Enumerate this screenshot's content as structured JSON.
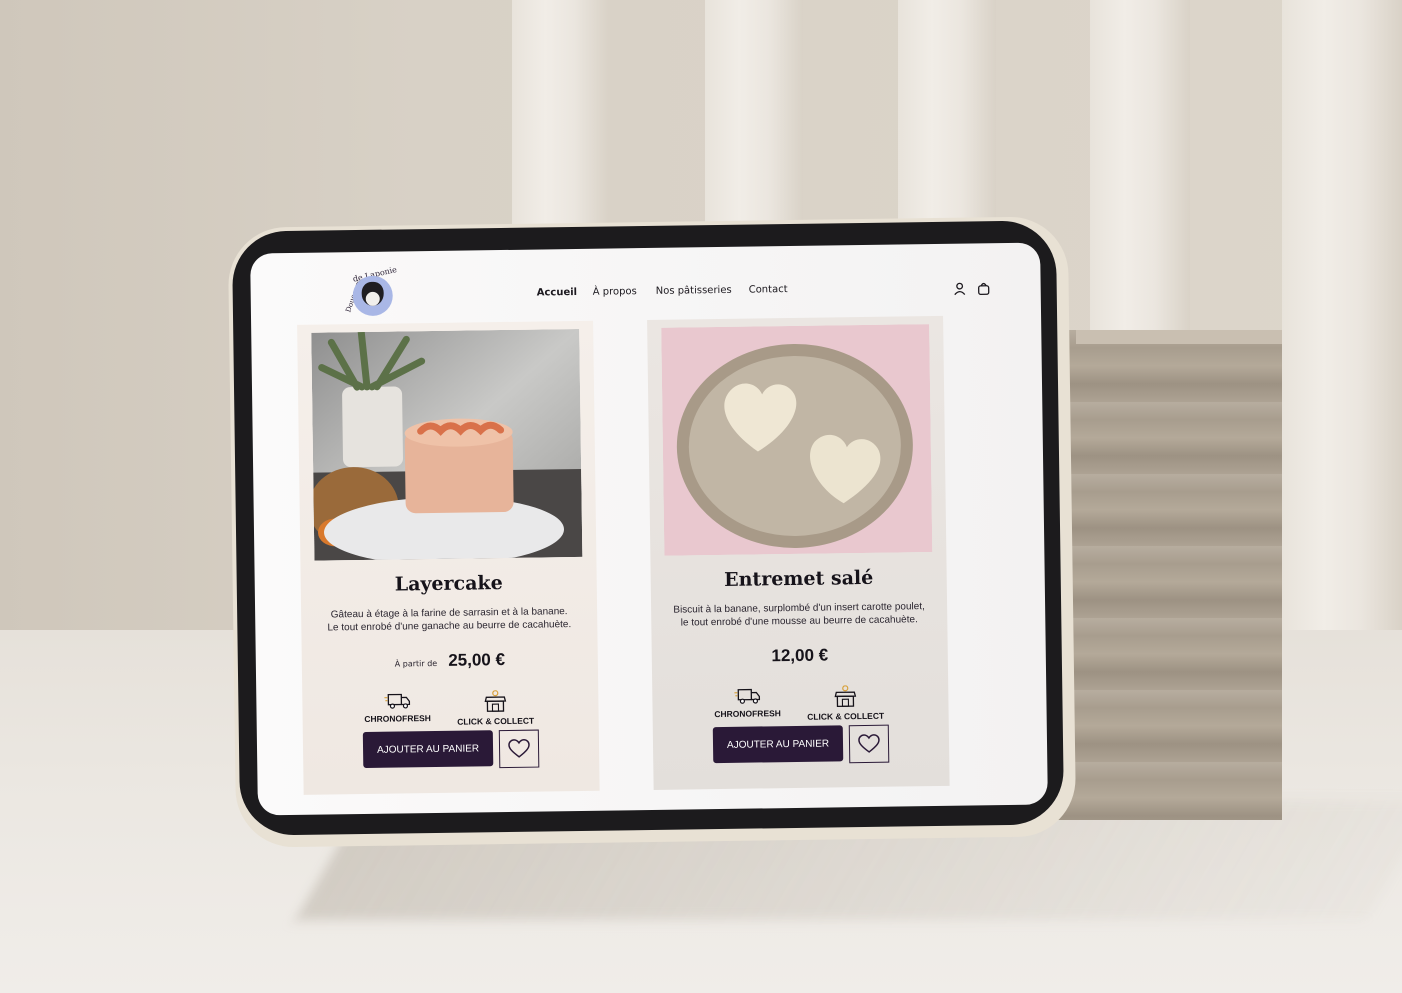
{
  "site": {
    "logo_text_top": "de Laponie",
    "logo_text_side": "Douceurs"
  },
  "nav": {
    "items": [
      {
        "label": "Accueil",
        "active": true
      },
      {
        "label": "À propos",
        "active": false
      },
      {
        "label": "Nos pâtisseries",
        "active": false
      },
      {
        "label": "Contact",
        "active": false
      }
    ],
    "icons": [
      "user-icon",
      "bag-icon"
    ]
  },
  "products": [
    {
      "title": "Layercake",
      "description_line1": "Gâteau à étage à la farine de sarrasin et à la banane.",
      "description_line2": "Le tout enrobé d'une ganache au beurre de cacahuète.",
      "price_prefix": "À partir de",
      "price": "25,00 €",
      "feature1": "CHRONOFRESH",
      "feature2": "CLICK & COLLECT",
      "cart_label": "AJOUTER AU PANIER",
      "photo_icon": "layercake-photo"
    },
    {
      "title": "Entremet salé",
      "description_line1": "Biscuit à la banane, surplombé d'un insert carotte poulet,",
      "description_line2": "le tout enrobé d'une mousse au beurre de cacahuète.",
      "price_prefix": "",
      "price": "12,00 €",
      "feature1": "CHRONOFRESH",
      "feature2": "CLICK & COLLECT",
      "cart_label": "AJOUTER AU PANIER",
      "photo_icon": "entremet-photo"
    }
  ],
  "colors": {
    "accent": "#2a1937",
    "card_bg": "#f1ebe6",
    "text": "#16131a"
  }
}
